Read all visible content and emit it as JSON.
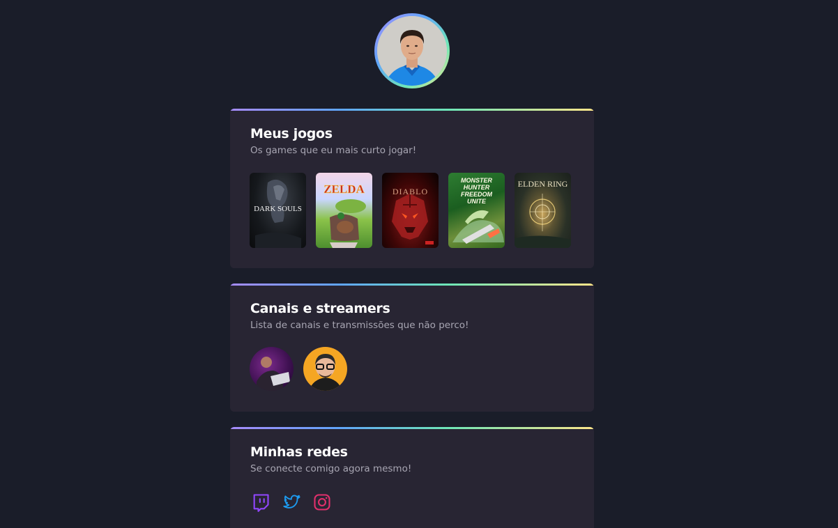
{
  "profile": {
    "avatar_alt": "profile-photo"
  },
  "games_section": {
    "title": "Meus jogos",
    "subtitle": "Os games que eu mais curto jogar!",
    "games": [
      {
        "title": "DARK SOULS"
      },
      {
        "title": "ZELDA"
      },
      {
        "title": "DIABLO"
      },
      {
        "title": "MONSTER HUNTER FREEDOM UNITE"
      },
      {
        "title": "ELDEN RING"
      }
    ]
  },
  "streamers_section": {
    "title": "Canais e streamers",
    "subtitle": "Lista de canais e transmissões que não perco!"
  },
  "social_section": {
    "title": "Minhas redes",
    "subtitle": "Se conecte comigo agora mesmo!",
    "icons": [
      "twitch-icon",
      "twitter-icon",
      "instagram-icon"
    ]
  },
  "colors": {
    "background": "#1a1d29",
    "card": "#282533",
    "twitch": "#9146ff",
    "twitter": "#1d9bf0",
    "instagram": "#e1306c"
  }
}
